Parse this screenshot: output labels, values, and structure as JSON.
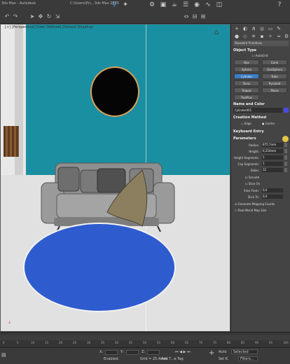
{
  "window": {
    "title_left": "3ds Max - Autodesk",
    "title_file": "C:\\Users\\Pc\\...3ds Max 2025"
  },
  "viewport": {
    "label": "[+] [Perspective] [User Defined] [Default Shading]"
  },
  "panel": {
    "category": "Standard Primitives",
    "object_type": "Object Type",
    "autogrid": "AutoGrid",
    "objects": [
      "Box",
      "Cone",
      "Sphere",
      "GeoSphere",
      "Cylinder",
      "Tube",
      "Torus",
      "Pyramid",
      "Teapot",
      "Plane",
      "TextPlus"
    ],
    "selected_object": "Cylinder",
    "name_and_color": "Name and Color",
    "object_name": "Cylinder001",
    "creation_method": "Creation Method",
    "edge": "Edge",
    "center": "Center",
    "keyboard_entry": "Keyboard Entry",
    "parameters": "Parameters",
    "radius_label": "Radius:",
    "radius": "875,7mm",
    "height_label": "Height:",
    "height": "0,254mm",
    "height_segments_label": "Height Segments:",
    "height_segments": "1",
    "cap_segments_label": "Cap Segments:",
    "cap_segments": "1",
    "sides_label": "Sides:",
    "sides": "32",
    "smooth": "Smooth",
    "slice_on": "Slice On",
    "slice_from": "Slice From:",
    "slice_to": "Slice To:",
    "slice_from_val": "0,0",
    "slice_to_val": "0,0",
    "gen_mapping": "Generate Mapping Coords.",
    "real_world": "Real-World Map Size"
  },
  "timeline": {
    "ticks": [
      "0",
      "5",
      "10",
      "15",
      "20",
      "25",
      "30",
      "35",
      "40",
      "45",
      "50",
      "55",
      "60",
      "65",
      "70",
      "75",
      "80",
      "85",
      "90",
      "95",
      "100"
    ]
  },
  "status": {
    "x": "X:",
    "y": "Y:",
    "z": "Z:",
    "enabled": "Enabled:",
    "grid": "Grid = 25,4mm",
    "add_time_tag": "Add T...e Tag",
    "auto": "Auto",
    "selected": "Selected",
    "set_k": "Set K.",
    "filters": "Filters..."
  }
}
